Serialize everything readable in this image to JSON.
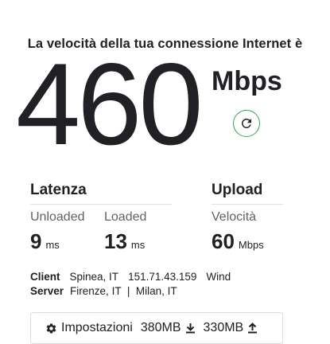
{
  "headline": "La velocità della tua connessione Internet è",
  "speed": {
    "value": "460",
    "unit": "Mbps",
    "refresh_icon": "refresh-icon",
    "accent": "#34a853"
  },
  "latency": {
    "title": "Latenza",
    "unloaded_label": "Unloaded",
    "loaded_label": "Loaded",
    "unloaded_value": "9",
    "unloaded_unit": "ms",
    "loaded_value": "13",
    "loaded_unit": "ms"
  },
  "upload": {
    "title": "Upload",
    "speed_label": "Velocità",
    "value": "60",
    "unit": "Mbps"
  },
  "client": {
    "label": "Client",
    "location": "Spinea, IT",
    "ip": "151.71.43.159",
    "isp": "Wind"
  },
  "server": {
    "label": "Server",
    "locations": "Firenze, IT  |  Milan, IT"
  },
  "settings": {
    "label": "Impostazioni",
    "icon": "gear-icon",
    "download_data": "380MB",
    "download_icon": "download-icon",
    "upload_data": "330MB",
    "upload_icon": "upload-icon"
  }
}
